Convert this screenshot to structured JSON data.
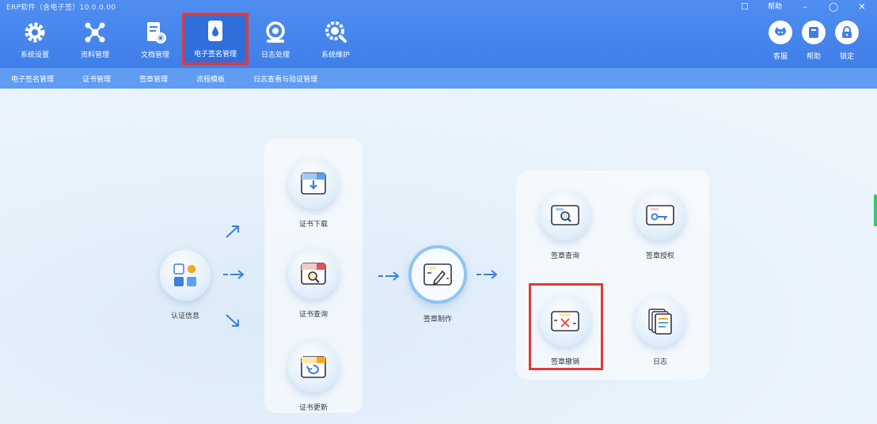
{
  "window": {
    "title": "ERP软件（含电子签）10.0.0.00"
  },
  "window_controls": {
    "chat": "☐",
    "help": "帮助",
    "minimize": "–",
    "restore": "◯",
    "close": "✕"
  },
  "toolbar": {
    "items": [
      {
        "label": "系统设置",
        "icon": "gear-icon"
      },
      {
        "label": "资料管理",
        "icon": "network-icon"
      },
      {
        "label": "文档管理",
        "icon": "document-settings-icon"
      },
      {
        "label": "电子签名管理",
        "icon": "water-drop-card-icon",
        "active": true
      },
      {
        "label": "日志处理",
        "icon": "magnifier-badge-icon"
      },
      {
        "label": "系统维护",
        "icon": "search-gear-icon"
      }
    ],
    "right": [
      {
        "label": "客服",
        "icon": "cat-service-icon"
      },
      {
        "label": "帮助",
        "icon": "book-icon"
      },
      {
        "label": "锁定",
        "icon": "lock-icon"
      }
    ]
  },
  "submenu": {
    "items": [
      "电子签名管理",
      "证书管理",
      "签章管理",
      "流程模板",
      "日志查看与验证管理"
    ]
  },
  "flow": {
    "start": {
      "label": "认证信息",
      "icon": "apps-grid-icon"
    },
    "cert_group": [
      {
        "label": "证书下载",
        "icon": "box-download-icon"
      },
      {
        "label": "证书查询",
        "icon": "box-search-icon"
      },
      {
        "label": "证书更新",
        "icon": "box-return-icon"
      }
    ],
    "center": {
      "label": "签章制作",
      "icon": "card-pen-icon"
    },
    "result_group": [
      {
        "label": "签章查询",
        "icon": "card-search-icon"
      },
      {
        "label": "签章授权",
        "icon": "card-key-icon"
      },
      {
        "label": "签章撤销",
        "icon": "card-cross-icon",
        "highlighted": true
      },
      {
        "label": "日志",
        "icon": "stacked-docs-icon"
      }
    ]
  },
  "colors": {
    "toolbar": "#3f7fe8",
    "submenu": "#5f9cf2",
    "highlight": "#e53935",
    "arrow": "#3b7fe0"
  }
}
